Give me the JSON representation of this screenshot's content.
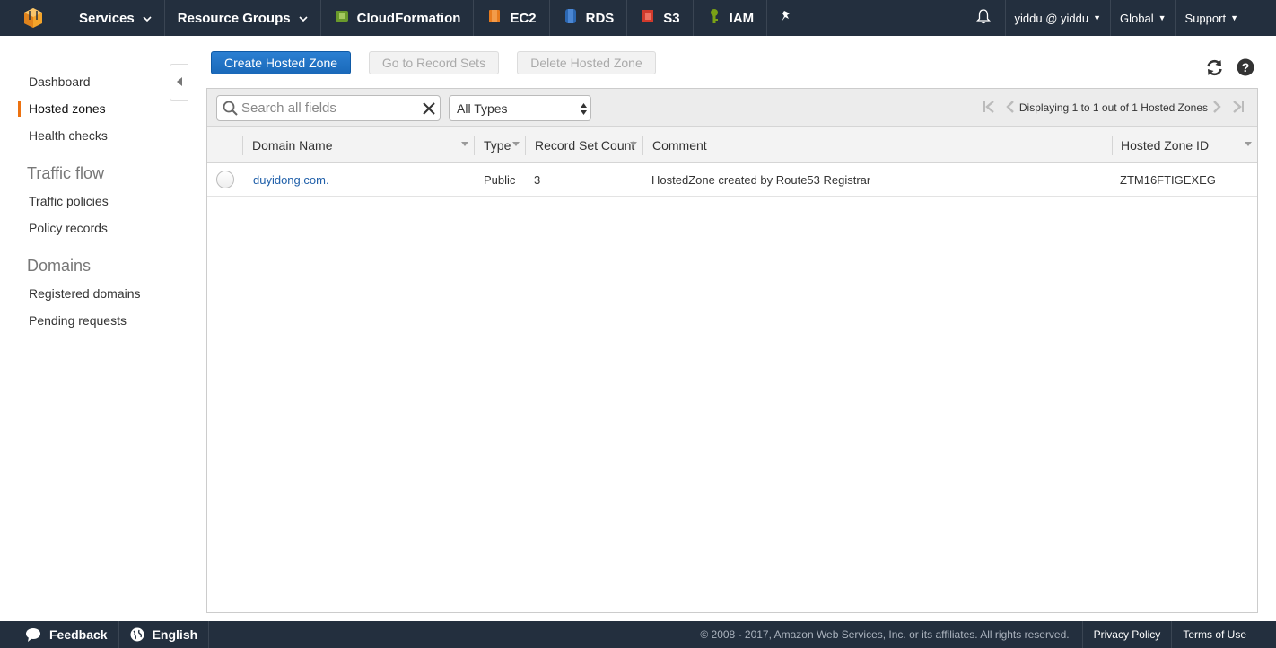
{
  "topnav": {
    "services": "Services",
    "resource_groups": "Resource Groups",
    "shortcuts": [
      {
        "label": "CloudFormation",
        "icon": "cloudformation-icon",
        "color": "#6a9a2b"
      },
      {
        "label": "EC2",
        "icon": "ec2-icon",
        "color": "#e77b1e"
      },
      {
        "label": "RDS",
        "icon": "rds-icon",
        "color": "#2c67b1"
      },
      {
        "label": "S3",
        "icon": "s3-icon",
        "color": "#d13a2c"
      },
      {
        "label": "IAM",
        "icon": "iam-icon",
        "color": "#7aa116"
      }
    ],
    "user": "yiddu @ yiddu",
    "region": "Global",
    "support": "Support"
  },
  "sidebar": {
    "items": [
      {
        "label": "Dashboard"
      },
      {
        "label": "Hosted zones",
        "active": true
      },
      {
        "label": "Health checks"
      }
    ],
    "traffic_flow": {
      "heading": "Traffic flow",
      "items": [
        {
          "label": "Traffic policies"
        },
        {
          "label": "Policy records"
        }
      ]
    },
    "domains": {
      "heading": "Domains",
      "items": [
        {
          "label": "Registered domains"
        },
        {
          "label": "Pending requests"
        }
      ]
    }
  },
  "toolbar": {
    "create": "Create Hosted Zone",
    "goto_records": "Go to Record Sets",
    "delete": "Delete Hosted Zone"
  },
  "filter": {
    "search_placeholder": "Search all fields",
    "type_selected": "All Types",
    "pager_text": "Displaying 1 to 1 out of 1 Hosted Zones"
  },
  "table": {
    "columns": [
      "Domain Name",
      "Type",
      "Record Set Count",
      "Comment",
      "Hosted Zone ID"
    ],
    "rows": [
      {
        "domain": "duyidong.com.",
        "type": "Public",
        "record_count": "3",
        "comment": "HostedZone created by Route53 Registrar",
        "zone_id": "ZTM16FTIGEXEG"
      }
    ]
  },
  "footer": {
    "feedback": "Feedback",
    "language": "English",
    "copyright": "© 2008 - 2017, Amazon Web Services, Inc. or its affiliates. All rights reserved.",
    "privacy": "Privacy Policy",
    "terms": "Terms of Use"
  },
  "colors": {
    "nav_bg": "#232f3e",
    "primary_button": "#1f73c7",
    "active_accent": "#ec7211",
    "link": "#1f5fa9"
  }
}
